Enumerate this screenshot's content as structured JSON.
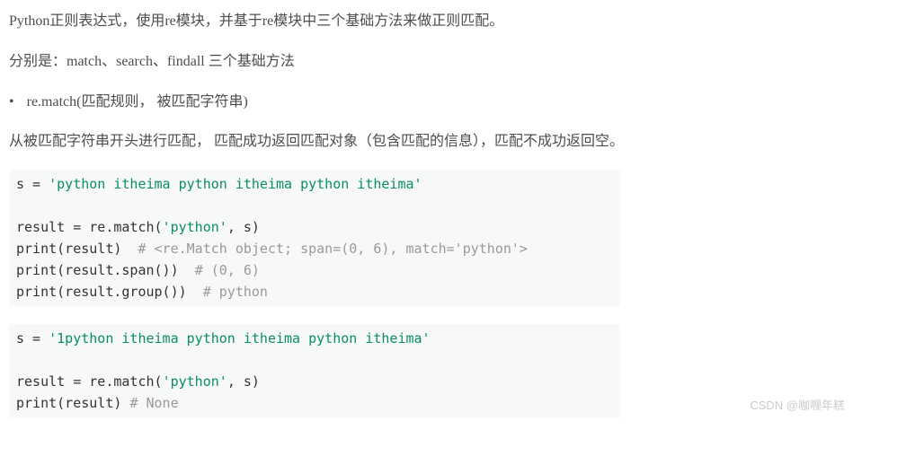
{
  "para1": "Python正则表达式，使用re模块，并基于re模块中三个基础方法来做正则匹配。",
  "para2": "分别是：match、search、findall 三个基础方法",
  "bullet1": "re.match(匹配规则， 被匹配字符串)",
  "para3": "从被匹配字符串开头进行匹配， 匹配成功返回匹配对象（包含匹配的信息），匹配不成功返回空。",
  "code1": {
    "l1a": "s = ",
    "l1b": "'python itheima python itheima python itheima'",
    "l3a": "result = re.match(",
    "l3b": "'python'",
    "l3c": ", s)",
    "l4a": "print(result)  ",
    "l4b": "# <re.Match object; span=(0, 6), match='python'>",
    "l5a": "print(result.span())  ",
    "l5b": "# (0, 6)",
    "l6a": "print(result.group())  ",
    "l6b": "# python"
  },
  "code2": {
    "l1a": "s = ",
    "l1b": "'1python itheima python itheima python itheima'",
    "l3a": "result = re.match(",
    "l3b": "'python'",
    "l3c": ", s)",
    "l4a": "print(result) ",
    "l4b": "# None"
  },
  "watermark": "CSDN @咖喱年糕"
}
